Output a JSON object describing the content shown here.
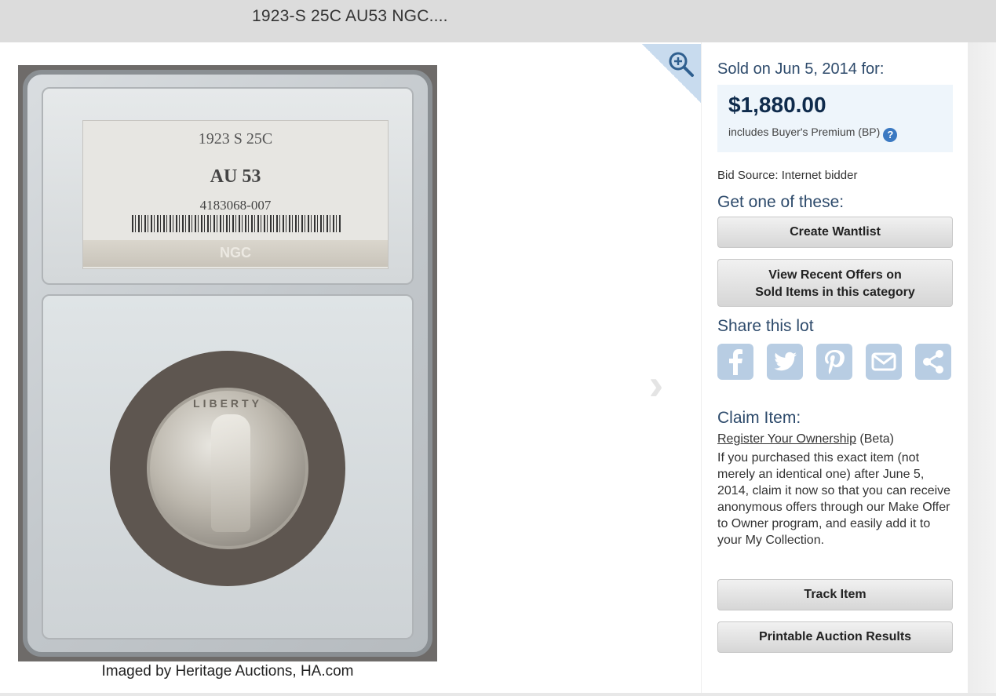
{
  "header": {
    "title": "1923-S 25C AU53 NGC...."
  },
  "image": {
    "slab_label": {
      "line1": "1923 S 25C",
      "line2": "AU 53",
      "line3": "4183068-007",
      "brand": "NGC"
    },
    "coin_legend": "LIBERTY",
    "caption": "Imaged by Heritage Auctions, HA.com",
    "zoom_icon": "zoom-in-icon",
    "next_icon": "chevron-right-icon"
  },
  "sale": {
    "sold_label": "Sold on Jun 5, 2014 for:",
    "price": "$1,880.00",
    "bp_note": "includes Buyer's Premium (BP)",
    "help_glyph": "?",
    "bid_source": "Bid Source: Internet bidder"
  },
  "get_one": {
    "title": "Get one of these:",
    "create_wantlist": "Create Wantlist",
    "view_offers_line1": "View Recent Offers on",
    "view_offers_line2": "Sold Items in this category"
  },
  "share": {
    "title": "Share this lot",
    "icons": [
      "facebook-icon",
      "twitter-icon",
      "pinterest-icon",
      "email-icon",
      "share-icon"
    ]
  },
  "claim": {
    "title": "Claim Item:",
    "link_text": "Register Your Ownership",
    "beta": " (Beta)",
    "body": "If you purchased this exact item (not merely an identical one) after June 5, 2014, claim it now so that you can receive anonymous offers through our Make Offer to Owner program, and easily add it to your My Collection."
  },
  "actions": {
    "track_item": "Track Item",
    "printable_results": "Printable Auction Results"
  },
  "colors": {
    "accent_text": "#2d4a6b",
    "price_box": "#eef5fb",
    "share_icon": "#b8cde3"
  }
}
